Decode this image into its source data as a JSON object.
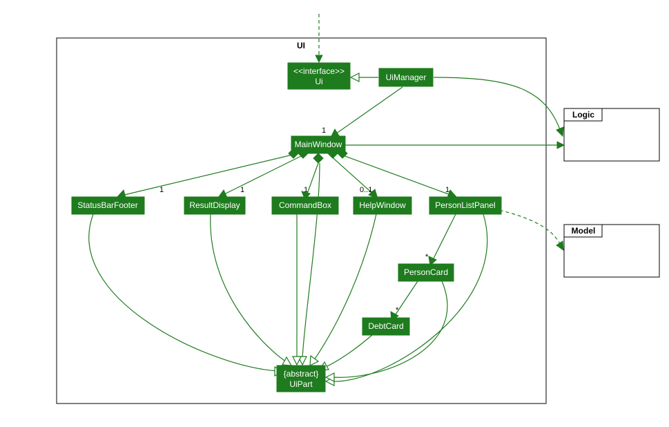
{
  "package": {
    "label": "UI"
  },
  "external": {
    "logic": "Logic",
    "model": "Model"
  },
  "nodes": {
    "ui_if": {
      "stereotype": "<<interface>>",
      "name": "Ui"
    },
    "ui_manager": {
      "name": "UiManager"
    },
    "main_window": {
      "name": "MainWindow"
    },
    "status_bar": {
      "name": "StatusBarFooter"
    },
    "result_display": {
      "name": "ResultDisplay"
    },
    "command_box": {
      "name": "CommandBox"
    },
    "help_window": {
      "name": "HelpWindow"
    },
    "person_list": {
      "name": "PersonListPanel"
    },
    "person_card": {
      "name": "PersonCard"
    },
    "debt_card": {
      "name": "DebtCard"
    },
    "ui_part": {
      "stereotype": "{abstract}",
      "name": "UiPart"
    }
  },
  "mult": {
    "mw": "1",
    "sb": "1",
    "rd": "1",
    "cb": "1",
    "hw": "0..1",
    "plp": "1",
    "pc": "*",
    "dc": "*"
  }
}
